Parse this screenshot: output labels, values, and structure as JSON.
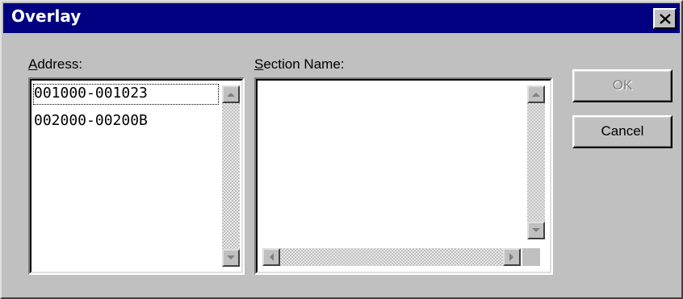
{
  "window": {
    "title": "Overlay",
    "close_label": "×"
  },
  "address": {
    "label_prefix": "A",
    "label_rest": "ddress:",
    "items": [
      "001000-001023",
      "002000-00200B"
    ]
  },
  "section": {
    "label_prefix": "S",
    "label_rest": "ection Name:",
    "items": []
  },
  "buttons": {
    "ok_label": "OK",
    "cancel_label": "Cancel"
  },
  "colors": {
    "titlebar": "#000080",
    "face": "#c0c0c0"
  }
}
